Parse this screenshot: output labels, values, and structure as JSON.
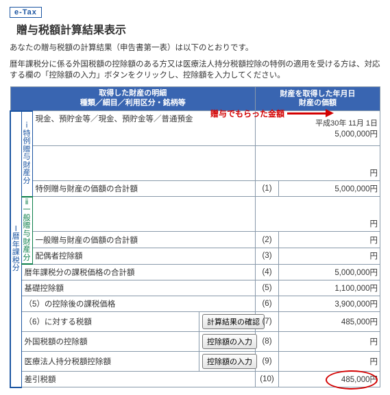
{
  "header": {
    "badge": "e-Tax",
    "title": "贈与税額計算結果表示",
    "desc1": "あなたの贈与税額の計算結果（申告書第一表）は以下のとおりです。",
    "desc2": "暦年課税分に係る外国税額の控除額のある方又は医療法人持分税額控除の特例の適用を受ける方は、対応する欄の「控除額の入力」ボタンをクリックし、控除額を入力してください。"
  },
  "table": {
    "col1": "取得した財産の明細\n種類／細目／利用区分・銘柄等",
    "col2": "財産を取得した年月日\n財産の価額",
    "side_labels": {
      "left_outer": "Ⅰ暦年課税分",
      "special": "ⅰ特例贈与財産分",
      "general": "ⅱ一般贈与財産分"
    },
    "special": {
      "asset_type": "現金、預貯金等／現金、預貯金等／普通預金",
      "date": "平成30年 11月 1日",
      "amount": "5,000,000円",
      "subtotal_label": "特例贈与財産の価額の合計額",
      "subtotal_amount": "5,000,000円"
    },
    "general": {
      "subtotal_label": "一般贈与財産の価額の合計額",
      "spouse_label": "配偶者控除額"
    },
    "rows": [
      {
        "label": "暦年課税分の課税価格の合計額",
        "no": "(4)",
        "val": "5,000,000円"
      },
      {
        "label": "基礎控除額",
        "no": "(5)",
        "val": "1,100,000円"
      },
      {
        "label": "（5）の控除後の課税価格",
        "no": "(6)",
        "val": "3,900,000円"
      },
      {
        "label": "（6）に対する税額",
        "btn": "計算結果の確認",
        "no": "(7)",
        "val": "485,000円"
      },
      {
        "label": "外国税額の控除額",
        "btn": "控除額の入力",
        "no": "(8)",
        "val": "円"
      },
      {
        "label": "医療法人持分税額控除額",
        "btn": "控除額の入力",
        "no": "(9)",
        "val": "円"
      },
      {
        "label": "差引税額",
        "no": "(10)",
        "val": "485,000円"
      }
    ],
    "no1": "(1)",
    "no2": "(2)",
    "no3": "(3)",
    "yen": "円"
  },
  "annotation": {
    "text": "贈与でもらった金額"
  }
}
